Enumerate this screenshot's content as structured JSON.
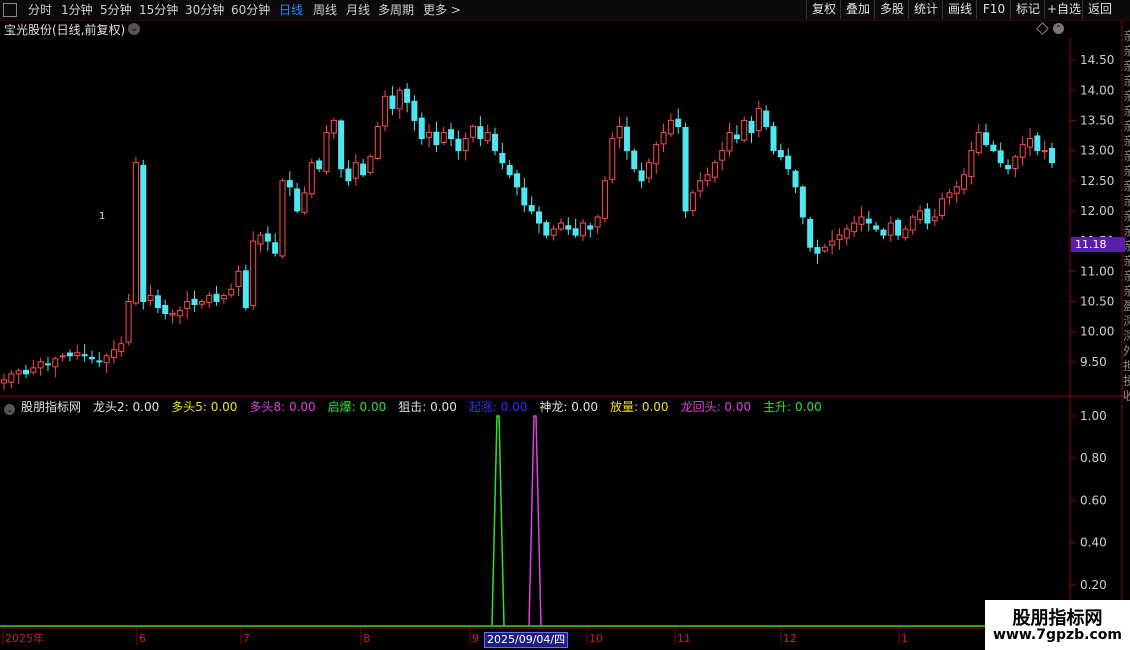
{
  "toolbar": {
    "left_items": [
      {
        "label": "分时",
        "x": 28
      },
      {
        "label": "1分钟",
        "x": 61
      },
      {
        "label": "5分钟",
        "x": 100
      },
      {
        "label": "15分钟",
        "x": 139
      },
      {
        "label": "30分钟",
        "x": 185
      },
      {
        "label": "60分钟",
        "x": 231
      },
      {
        "label": "日线",
        "x": 279,
        "active": true
      },
      {
        "label": "周线",
        "x": 313
      },
      {
        "label": "月线",
        "x": 346
      },
      {
        "label": "多周期",
        "x": 378
      },
      {
        "label": "更多 >",
        "x": 423
      }
    ],
    "right_items": [
      "复权",
      "叠加",
      "多股",
      "统计",
      "画线",
      "F10",
      "标记",
      "+自选",
      "返回"
    ]
  },
  "stock_title": "宝光股份(日线,前复权)",
  "price_axis": {
    "labels": [
      "14.50",
      "14.00",
      "13.50",
      "13.00",
      "12.50",
      "12.00",
      "11.50",
      "11.00",
      "10.50",
      "10.00",
      "9.50"
    ]
  },
  "price_tag": "11.18",
  "indicator": {
    "name": "股朋指标网",
    "items": [
      {
        "label": "龙头2: 0.00",
        "color": "#e0e0e0"
      },
      {
        "label": "多头5: 0.00",
        "color": "#f0e020"
      },
      {
        "label": "多头8: 0.00",
        "color": "#e040e0"
      },
      {
        "label": "启爆: 0.00",
        "color": "#30e030"
      },
      {
        "label": "狙击: 0.00",
        "color": "#e0e0e0"
      },
      {
        "label": "起涨: 0.00",
        "color": "#3030ff"
      },
      {
        "label": "神龙: 0.00",
        "color": "#e0e0e0"
      },
      {
        "label": "放量: 0.00",
        "color": "#f0e020"
      },
      {
        "label": "龙回头: 0.00",
        "color": "#e040e0"
      },
      {
        "label": "主升: 0.00",
        "color": "#30e030"
      }
    ],
    "axis_labels": [
      "1.00",
      "0.80",
      "0.60",
      "0.40",
      "0.20"
    ],
    "spikes": [
      {
        "color": "#30e030",
        "value": 1.0
      },
      {
        "color": "#e040e0",
        "value": 1.0
      }
    ]
  },
  "time_axis": {
    "labels": [
      "2025年",
      "6",
      "7",
      "8",
      "9",
      "10",
      "11",
      "12",
      "1"
    ]
  },
  "date_cursor": "2025/09/04/四",
  "right_sidebar_chars": "亲亲亲亲亲亲亲亲亲亲亲亲亲亲亲亲亲亲盈深深外担投收",
  "candle_annotation": "1",
  "watermark": {
    "title": "股朋指标网",
    "url": "www.7gpzb.com"
  },
  "colors": {
    "up": "#ff4a4a",
    "down": "#4ee6f0",
    "axis": "#8a0000",
    "bg": "#000000"
  },
  "chart_data": {
    "type": "candlestick",
    "ylim": [
      9.0,
      14.8
    ],
    "closes": [
      9.2,
      9.3,
      9.35,
      9.3,
      9.4,
      9.5,
      9.45,
      9.55,
      9.6,
      9.6,
      9.65,
      9.6,
      9.55,
      9.5,
      9.6,
      9.7,
      9.8,
      10.5,
      12.8,
      10.5,
      10.6,
      10.4,
      10.3,
      10.3,
      10.35,
      10.5,
      10.45,
      10.5,
      10.6,
      10.5,
      10.6,
      10.7,
      11.0,
      10.4,
      11.5,
      11.6,
      11.5,
      11.3,
      12.5,
      12.4,
      12.0,
      12.3,
      12.8,
      12.7,
      13.3,
      13.5,
      12.7,
      12.5,
      12.8,
      12.6,
      12.9,
      13.4,
      13.9,
      13.7,
      14.0,
      13.8,
      13.5,
      13.2,
      13.3,
      13.1,
      13.3,
      13.2,
      13.0,
      13.2,
      13.4,
      13.2,
      13.3,
      13.0,
      12.8,
      12.6,
      12.4,
      12.1,
      12.0,
      11.8,
      11.6,
      11.7,
      11.8,
      11.7,
      11.6,
      11.8,
      11.7,
      11.9,
      12.5,
      13.2,
      13.4,
      13.0,
      12.7,
      12.5,
      12.8,
      13.1,
      13.3,
      13.5,
      13.4,
      12.0,
      12.3,
      12.5,
      12.6,
      12.8,
      13.0,
      13.3,
      13.2,
      13.5,
      13.3,
      13.7,
      13.4,
      13.0,
      12.9,
      12.7,
      12.4,
      11.9,
      11.4,
      11.3,
      11.4,
      11.5,
      11.6,
      11.7,
      11.8,
      11.9,
      11.8,
      11.7,
      11.6,
      11.8,
      11.6,
      11.7,
      11.9,
      12.0,
      11.8,
      11.9,
      12.2,
      12.3,
      12.4,
      12.6,
      13.0,
      13.3,
      13.1,
      13.0,
      12.8,
      12.7,
      12.9,
      13.1,
      13.2,
      13.0,
      13.0,
      12.8
    ]
  }
}
